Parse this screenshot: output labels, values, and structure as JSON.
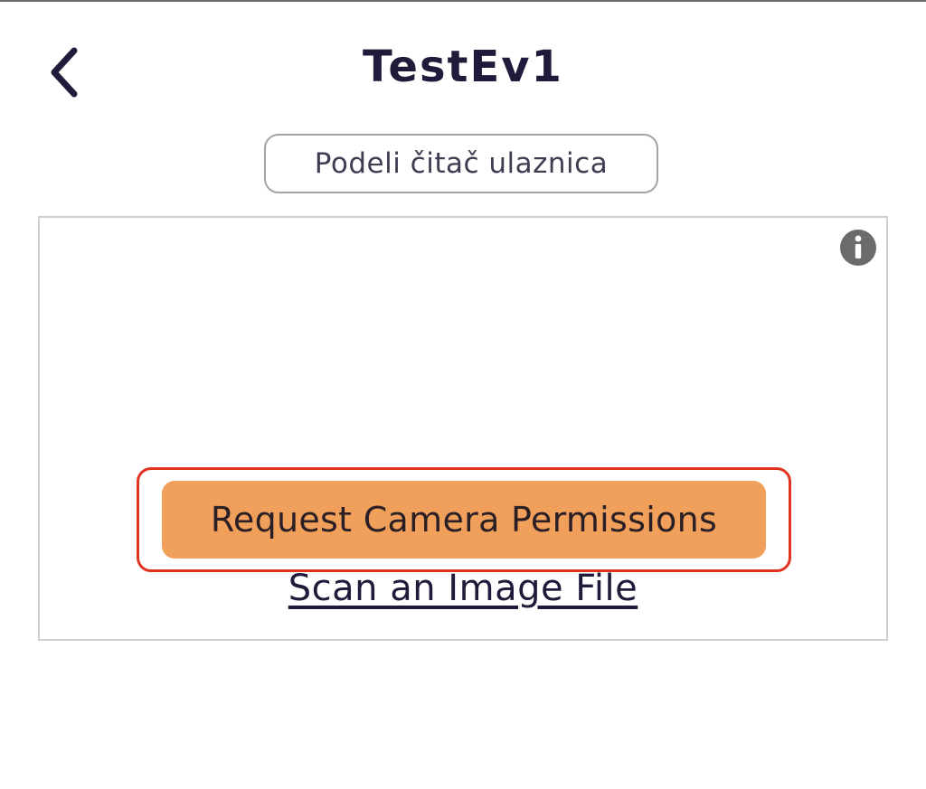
{
  "header": {
    "title": "TestEv1",
    "back_icon": "chevron-left-icon"
  },
  "share_reader": {
    "label": "Podeli čitač ulaznica"
  },
  "scanner": {
    "info_icon": "info-icon",
    "request_camera_label": "Request Camera Permissions",
    "scan_file_label": "Scan an Image File"
  },
  "colors": {
    "title_text": "#1f1b3a",
    "accent_button": "#f0a05a",
    "highlight_border": "#e0321f",
    "panel_border": "#cfcfcf",
    "info_icon_fill": "#6b6b6b"
  }
}
